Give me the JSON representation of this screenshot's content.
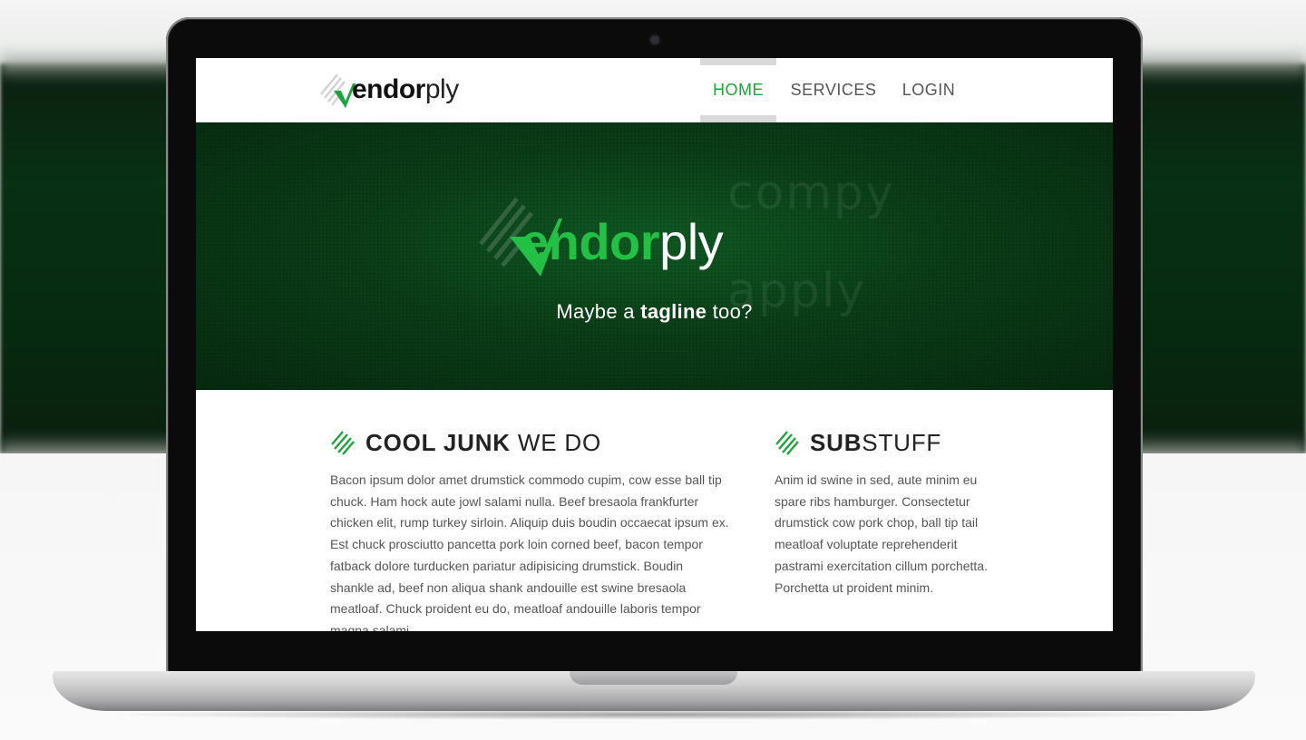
{
  "colors": {
    "brand_green": "#1aa63a",
    "hero_green": "#0a3e17",
    "nav_active_bar": "#d9d9d9"
  },
  "header": {
    "logo": {
      "strong": "endor",
      "light": "ply",
      "mark_icon": "checkmark-stripes-logo-icon"
    },
    "nav": [
      {
        "label": "HOME",
        "active": true
      },
      {
        "label": "SERVICES",
        "active": false
      },
      {
        "label": "LOGIN",
        "active": false
      }
    ]
  },
  "hero": {
    "logo": {
      "strong": "endor",
      "light": "ply"
    },
    "ghost_words": [
      "compy",
      "apply"
    ],
    "tagline": {
      "before": "Maybe a ",
      "bold": "tagline",
      "after": " too?"
    }
  },
  "sections": [
    {
      "icon": "diagonal-stripes-icon",
      "title_bold": "COOL JUNK",
      "title_light": " WE DO",
      "body": "Bacon ipsum dolor amet drumstick commodo cupim, cow esse ball tip chuck. Ham hock aute jowl salami nulla. Beef bresaola frankfurter chicken elit, rump turkey sirloin. Aliquip duis boudin occaecat ipsum ex. Est chuck prosciutto pancetta pork loin corned beef, bacon tempor fatback dolore turducken pariatur adipisicing drumstick. Boudin shankle ad, beef non aliqua shank andouille est swine bresaola meatloaf. Chuck proident eu do, meatloaf andouille laboris tempor magna salami."
    },
    {
      "icon": "diagonal-stripes-icon",
      "title_bold": "SUB",
      "title_light": "STUFF",
      "body": "Anim id swine in sed, aute minim eu spare ribs hamburger. Consectetur drumstick cow pork chop, ball tip tail meatloaf voluptate reprehenderit pastrami exercitation cillum porchetta. Porchetta ut proident minim."
    }
  ]
}
